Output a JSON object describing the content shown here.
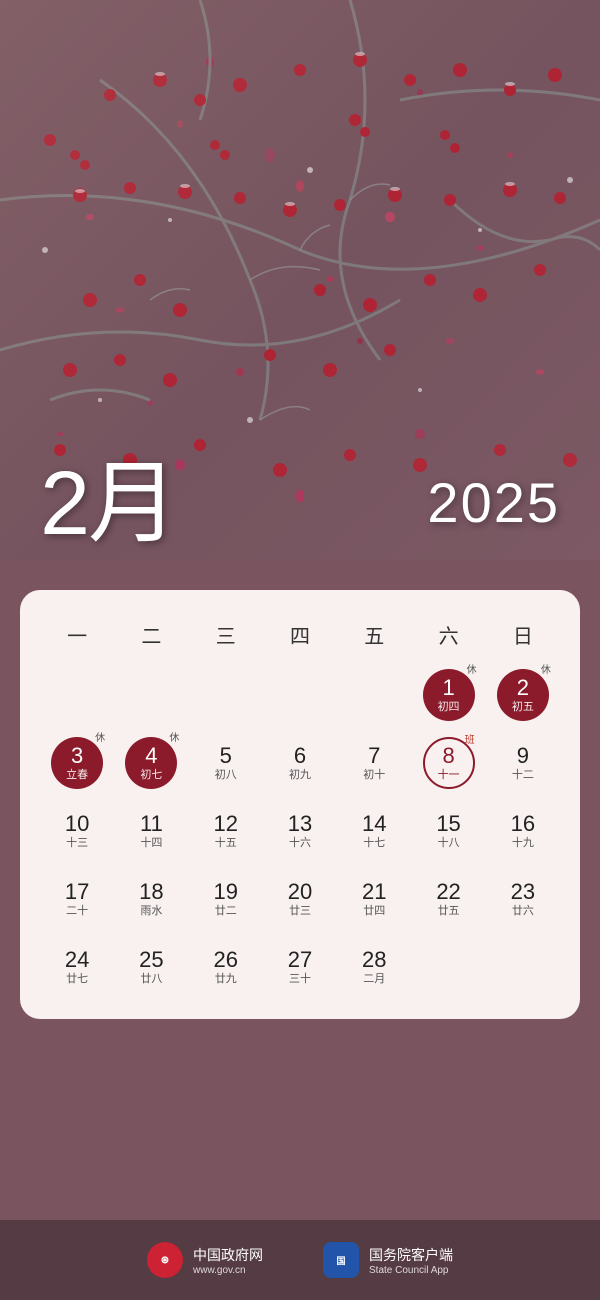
{
  "photo": {
    "alt": "Snow-covered red berries on branches"
  },
  "header": {
    "month": "2月",
    "year": "2025"
  },
  "calendar": {
    "day_headers": [
      "一",
      "二",
      "三",
      "四",
      "五",
      "六",
      "日"
    ],
    "weeks": [
      [
        {
          "day": "",
          "lunar": "",
          "badge": "",
          "type": "empty"
        },
        {
          "day": "",
          "lunar": "",
          "badge": "",
          "type": "empty"
        },
        {
          "day": "",
          "lunar": "",
          "badge": "",
          "type": "empty"
        },
        {
          "day": "",
          "lunar": "",
          "badge": "",
          "type": "empty"
        },
        {
          "day": "",
          "lunar": "",
          "badge": "",
          "type": "empty"
        },
        {
          "day": "1",
          "lunar": "初四",
          "badge": "休",
          "type": "holiday"
        },
        {
          "day": "2",
          "lunar": "初五",
          "badge": "休",
          "type": "holiday"
        }
      ],
      [
        {
          "day": "3",
          "lunar": "立春",
          "badge": "休",
          "type": "holiday"
        },
        {
          "day": "4",
          "lunar": "初七",
          "badge": "休",
          "type": "holiday"
        },
        {
          "day": "5",
          "lunar": "初八",
          "badge": "",
          "type": "normal"
        },
        {
          "day": "6",
          "lunar": "初九",
          "badge": "",
          "type": "normal"
        },
        {
          "day": "7",
          "lunar": "初十",
          "badge": "",
          "type": "normal"
        },
        {
          "day": "8",
          "lunar": "十一",
          "badge": "班",
          "type": "today"
        },
        {
          "day": "9",
          "lunar": "十二",
          "badge": "",
          "type": "normal"
        }
      ],
      [
        {
          "day": "10",
          "lunar": "十三",
          "badge": "",
          "type": "normal"
        },
        {
          "day": "11",
          "lunar": "十四",
          "badge": "",
          "type": "normal"
        },
        {
          "day": "12",
          "lunar": "十五",
          "badge": "",
          "type": "normal"
        },
        {
          "day": "13",
          "lunar": "十六",
          "badge": "",
          "type": "normal"
        },
        {
          "day": "14",
          "lunar": "十七",
          "badge": "",
          "type": "normal"
        },
        {
          "day": "15",
          "lunar": "十八",
          "badge": "",
          "type": "normal"
        },
        {
          "day": "16",
          "lunar": "十九",
          "badge": "",
          "type": "normal"
        }
      ],
      [
        {
          "day": "17",
          "lunar": "二十",
          "badge": "",
          "type": "normal"
        },
        {
          "day": "18",
          "lunar": "雨水",
          "badge": "",
          "type": "normal"
        },
        {
          "day": "19",
          "lunar": "廿二",
          "badge": "",
          "type": "normal"
        },
        {
          "day": "20",
          "lunar": "廿三",
          "badge": "",
          "type": "normal"
        },
        {
          "day": "21",
          "lunar": "廿四",
          "badge": "",
          "type": "normal"
        },
        {
          "day": "22",
          "lunar": "廿五",
          "badge": "",
          "type": "normal"
        },
        {
          "day": "23",
          "lunar": "廿六",
          "badge": "",
          "type": "normal"
        }
      ],
      [
        {
          "day": "24",
          "lunar": "廿七",
          "badge": "",
          "type": "normal"
        },
        {
          "day": "25",
          "lunar": "廿八",
          "badge": "",
          "type": "normal"
        },
        {
          "day": "26",
          "lunar": "廿九",
          "badge": "",
          "type": "normal"
        },
        {
          "day": "27",
          "lunar": "三十",
          "badge": "",
          "type": "normal"
        },
        {
          "day": "28",
          "lunar": "二月",
          "badge": "",
          "type": "normal"
        },
        {
          "day": "",
          "lunar": "",
          "badge": "",
          "type": "empty"
        },
        {
          "day": "",
          "lunar": "",
          "badge": "",
          "type": "empty"
        }
      ]
    ]
  },
  "footer": {
    "logo1_text": "国徽",
    "brand1_main": "中国政府网",
    "brand1_sub": "www.gov.cn",
    "logo2_text": "国务院",
    "brand2_main": "国务院客户端",
    "brand2_sub": "State Council App"
  }
}
